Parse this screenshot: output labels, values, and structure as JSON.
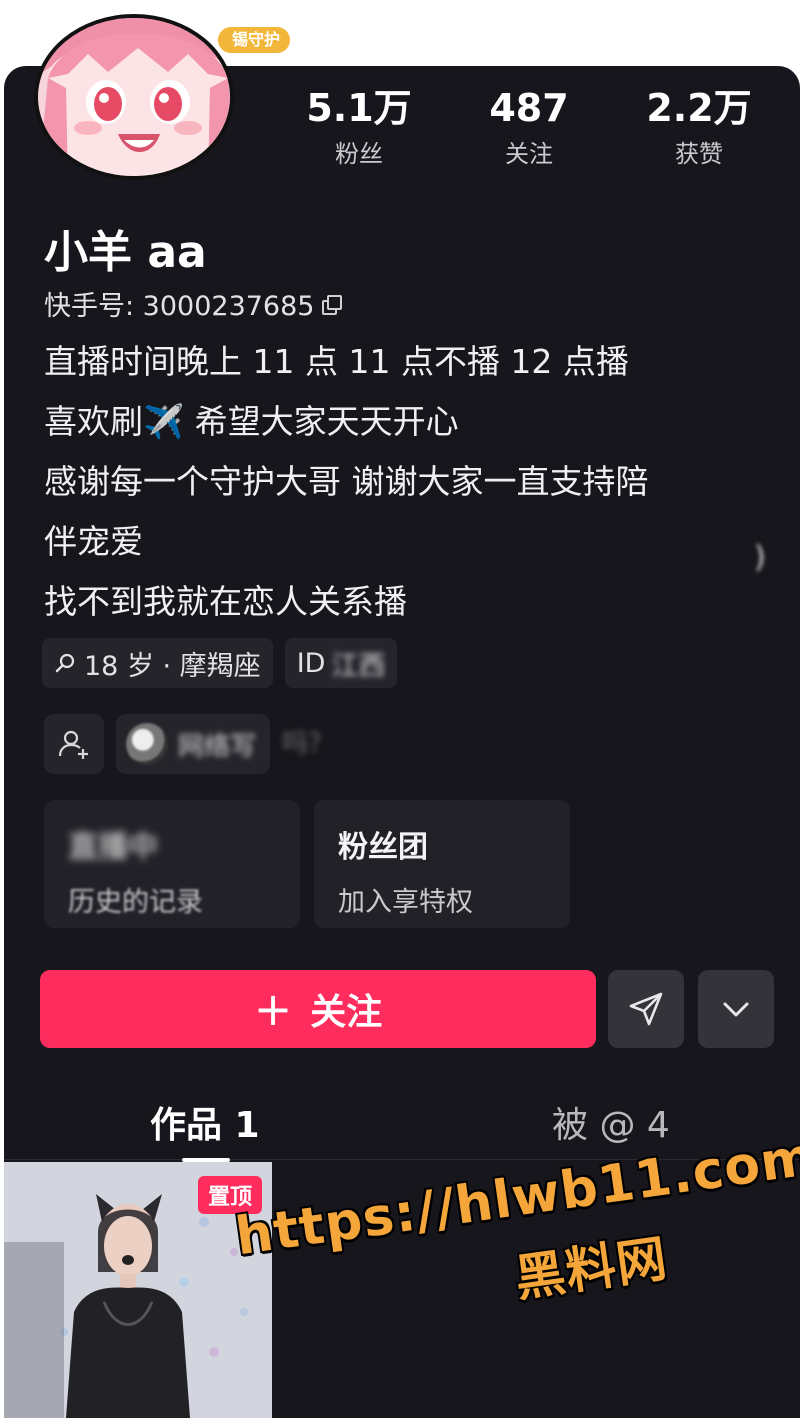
{
  "header": {
    "guard_badge": "锡守护"
  },
  "profile": {
    "stats": [
      {
        "value": "5.1万",
        "label": "粉丝"
      },
      {
        "value": "487",
        "label": "关注"
      },
      {
        "value": "2.2万",
        "label": "获赞"
      }
    ],
    "name": "小羊 aa",
    "kuaishou_id": "快手号: 3000237685",
    "bio": [
      "直播时间晚上 11 点 11 点不播 12 点播",
      "喜欢刷✈️ 希望大家天天开心",
      "感谢每一个守护大哥 谢谢大家一直支持陪",
      "伴宠爱",
      "找不到我就在恋人关系播"
    ],
    "tags": {
      "age_zodiac": "18 岁 · 摩羯座",
      "ip_label": "ID",
      "ip_value": "江西"
    },
    "friend_chip_text": "网络写",
    "ghost_text": "吗？",
    "cards": [
      {
        "title": "直播中",
        "subtitle": "历史的记录"
      },
      {
        "title": "粉丝团",
        "subtitle": "加入享特权"
      }
    ]
  },
  "actions": {
    "follow_label": "关注"
  },
  "tabs": [
    {
      "label": "作品 1"
    },
    {
      "label": "被 @ 4"
    }
  ],
  "content": {
    "pin_badge": "置顶"
  },
  "watermark": {
    "url": "https://hlwb11.com",
    "name": "黑料网"
  },
  "colors": {
    "background": "#17161c",
    "accent": "#ff2d5d",
    "watermark": "#f4a63a"
  }
}
